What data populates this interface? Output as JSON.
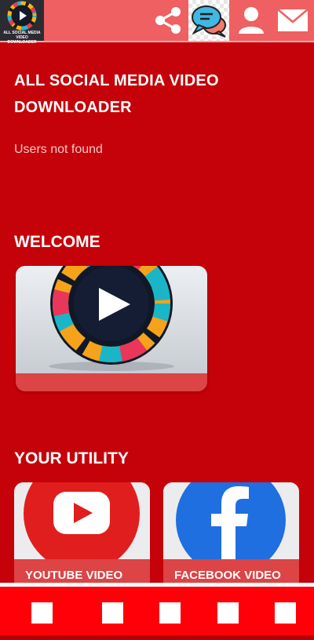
{
  "topbar": {
    "logo_caption": "ALL SOCIAL MEDIA VIDEO DOWNLOADER",
    "icons": [
      "share-icon",
      "chat-icon",
      "user-icon",
      "mail-icon"
    ]
  },
  "main": {
    "title": "ALL SOCIAL MEDIA VIDEO DOWNLOADER",
    "status": "Users not found",
    "welcome_heading": "WELCOME",
    "utility_heading": "YOUR UTILITY",
    "utilities": [
      {
        "label": "YOUTUBE VIDEO",
        "icon": "youtube-icon"
      },
      {
        "label": "FACEBOOK VIDEO",
        "icon": "facebook-icon"
      }
    ]
  },
  "bottom_nav": {
    "items": 5
  },
  "colors": {
    "background": "#c50109",
    "topbar": "#ee6061",
    "card_label": "#dc4445",
    "bottom_nav": "#ff0009"
  }
}
